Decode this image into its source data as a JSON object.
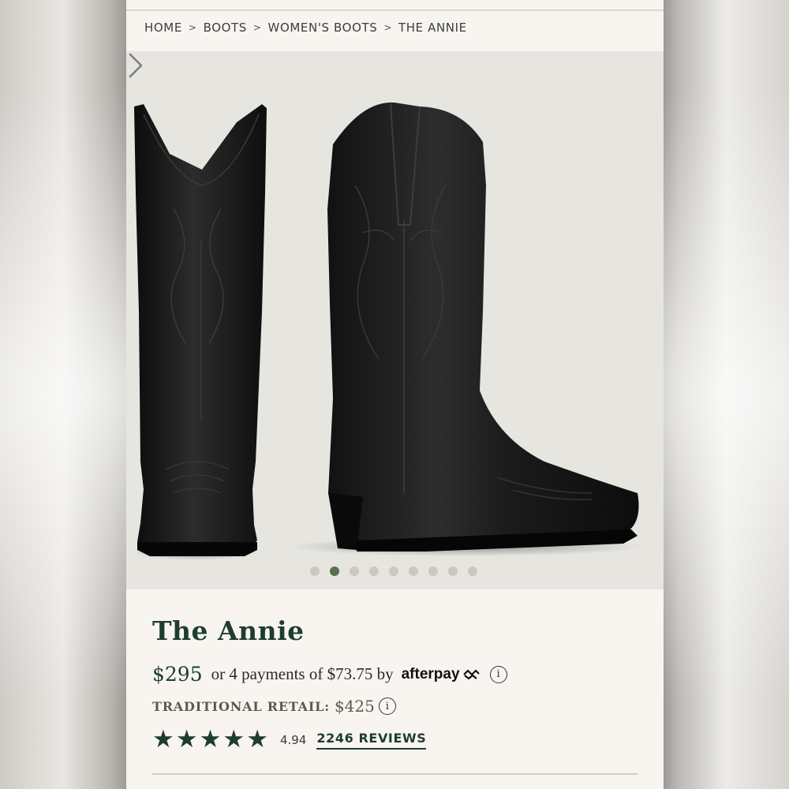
{
  "breadcrumb": {
    "items": [
      "HOME",
      "BOOTS",
      "WOMEN'S BOOTS",
      "THE ANNIE"
    ],
    "separator": ">"
  },
  "gallery": {
    "total_images": 9,
    "active_index": 1,
    "icons": {
      "next": "chevron-right-icon"
    }
  },
  "product": {
    "name": "The Annie",
    "price": "$295",
    "installments_text": "or 4 payments of $73.75 by",
    "afterpay_label": "afterpay",
    "traditional_retail_label": "TRADITIONAL RETAIL:",
    "traditional_retail_price": "$425",
    "rating_value": "4.94",
    "rating_stars": 5,
    "reviews_label": "2246 REVIEWS"
  },
  "colors": {
    "brand_green": "#1f3d2e",
    "active_dot": "#58704c",
    "inactive_dot": "#c9c9bd",
    "page_bg": "#f8f5f1",
    "hero_bg": "#e6e5e0"
  }
}
